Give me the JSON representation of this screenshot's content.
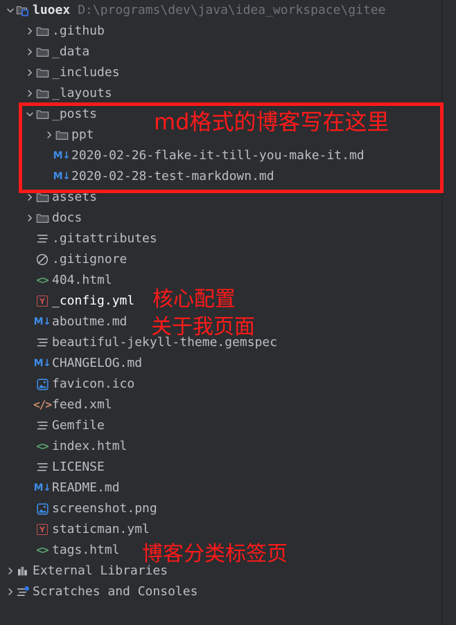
{
  "theme": {
    "background": "#2b2d30",
    "selection": "#3574f0",
    "text": "#bcbec4",
    "muted_text": "#6f737a",
    "annotation_red": "#ff1a1a",
    "markdown_blue": "#3f8ce8",
    "html_green": "#5a9e6f",
    "xml_orange": "#cf8e6d",
    "yaml_red": "#c9504f"
  },
  "tree": {
    "rows": [
      {
        "indent": 0,
        "twisty": "expanded",
        "icon": "module-folder-icon",
        "label": "luoex",
        "bold": true,
        "path": "D:\\programs\\dev\\java\\idea_workspace\\gitee",
        "selected": false
      },
      {
        "indent": 1,
        "twisty": "collapsed",
        "icon": "folder-icon",
        "label": ".github",
        "bold": false,
        "path": "",
        "selected": false
      },
      {
        "indent": 1,
        "twisty": "collapsed",
        "icon": "folder-icon",
        "label": "_data",
        "bold": false,
        "path": "",
        "selected": false
      },
      {
        "indent": 1,
        "twisty": "collapsed",
        "icon": "folder-icon",
        "label": "_includes",
        "bold": false,
        "path": "",
        "selected": false
      },
      {
        "indent": 1,
        "twisty": "collapsed",
        "icon": "folder-icon",
        "label": "_layouts",
        "bold": false,
        "path": "",
        "selected": false
      },
      {
        "indent": 1,
        "twisty": "expanded",
        "icon": "folder-icon",
        "label": "_posts",
        "bold": false,
        "path": "",
        "selected": false
      },
      {
        "indent": 2,
        "twisty": "collapsed",
        "icon": "folder-icon",
        "label": "ppt",
        "bold": false,
        "path": "",
        "selected": false
      },
      {
        "indent": 2,
        "twisty": "none",
        "icon": "markdown-icon",
        "label": "2020-02-26-flake-it-till-you-make-it.md",
        "bold": false,
        "path": "",
        "selected": false
      },
      {
        "indent": 2,
        "twisty": "none",
        "icon": "markdown-icon",
        "label": "2020-02-28-test-markdown.md",
        "bold": false,
        "path": "",
        "selected": false
      },
      {
        "indent": 1,
        "twisty": "collapsed",
        "icon": "folder-icon",
        "label": "assets",
        "bold": false,
        "path": "",
        "selected": false
      },
      {
        "indent": 1,
        "twisty": "collapsed",
        "icon": "folder-icon",
        "label": "docs",
        "bold": false,
        "path": "",
        "selected": false
      },
      {
        "indent": 1,
        "twisty": "none",
        "icon": "text-file-icon",
        "label": ".gitattributes",
        "bold": false,
        "path": "",
        "selected": false
      },
      {
        "indent": 1,
        "twisty": "none",
        "icon": "gitignore-icon",
        "label": ".gitignore",
        "bold": false,
        "path": "",
        "selected": false
      },
      {
        "indent": 1,
        "twisty": "none",
        "icon": "html-file-icon",
        "label": "404.html",
        "bold": false,
        "path": "",
        "selected": false
      },
      {
        "indent": 1,
        "twisty": "none",
        "icon": "yaml-file-icon",
        "label": "_config.yml",
        "bold": false,
        "path": "",
        "selected": true
      },
      {
        "indent": 1,
        "twisty": "none",
        "icon": "markdown-icon",
        "label": "aboutme.md",
        "bold": false,
        "path": "",
        "selected": false
      },
      {
        "indent": 1,
        "twisty": "none",
        "icon": "text-file-icon",
        "label": "beautiful-jekyll-theme.gemspec",
        "bold": false,
        "path": "",
        "selected": false
      },
      {
        "indent": 1,
        "twisty": "none",
        "icon": "markdown-icon",
        "label": "CHANGELOG.md",
        "bold": false,
        "path": "",
        "selected": false
      },
      {
        "indent": 1,
        "twisty": "none",
        "icon": "image-file-icon",
        "label": "favicon.ico",
        "bold": false,
        "path": "",
        "selected": false
      },
      {
        "indent": 1,
        "twisty": "none",
        "icon": "xml-file-icon",
        "label": "feed.xml",
        "bold": false,
        "path": "",
        "selected": false
      },
      {
        "indent": 1,
        "twisty": "none",
        "icon": "text-file-icon",
        "label": "Gemfile",
        "bold": false,
        "path": "",
        "selected": false
      },
      {
        "indent": 1,
        "twisty": "none",
        "icon": "html-file-icon",
        "label": "index.html",
        "bold": false,
        "path": "",
        "selected": false
      },
      {
        "indent": 1,
        "twisty": "none",
        "icon": "text-file-icon",
        "label": "LICENSE",
        "bold": false,
        "path": "",
        "selected": false
      },
      {
        "indent": 1,
        "twisty": "none",
        "icon": "markdown-icon",
        "label": "README.md",
        "bold": false,
        "path": "",
        "selected": false
      },
      {
        "indent": 1,
        "twisty": "none",
        "icon": "image-file-icon",
        "label": "screenshot.png",
        "bold": false,
        "path": "",
        "selected": false
      },
      {
        "indent": 1,
        "twisty": "none",
        "icon": "yaml-file-icon",
        "label": "staticman.yml",
        "bold": false,
        "path": "",
        "selected": false
      },
      {
        "indent": 1,
        "twisty": "none",
        "icon": "html-file-icon",
        "label": "tags.html",
        "bold": false,
        "path": "",
        "selected": false
      },
      {
        "indent": 0,
        "twisty": "collapsed",
        "icon": "external-libraries-icon",
        "label": "External Libraries",
        "bold": false,
        "path": "",
        "selected": false
      },
      {
        "indent": 0,
        "twisty": "collapsed",
        "icon": "scratches-icon",
        "label": "Scratches and Consoles",
        "bold": false,
        "path": "",
        "selected": false
      }
    ]
  },
  "annotations": {
    "posts_note": "md格式的博客写在这里",
    "config_note": "核心配置",
    "aboutme_note": "关于我页面",
    "tags_note": "博客分类标签页"
  }
}
